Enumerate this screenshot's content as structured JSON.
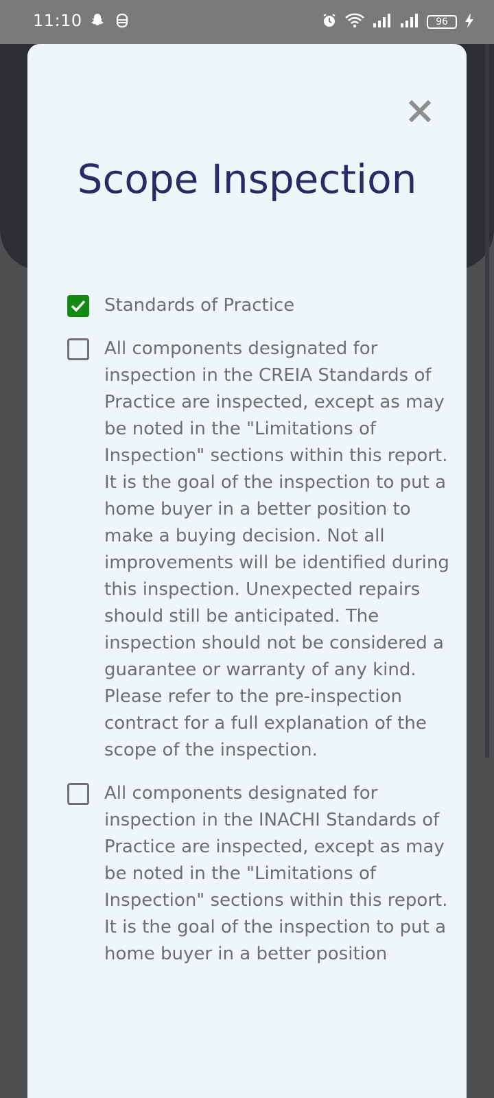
{
  "status_bar": {
    "time": "11:10",
    "battery": "96",
    "left_icons": [
      "snapchat-icon",
      "app-notification-icon"
    ],
    "right_icons": [
      "alarm-icon",
      "wifi-icon",
      "signal-icon",
      "signal-icon",
      "battery-icon",
      "charging-icon"
    ]
  },
  "modal": {
    "close_icon": "close-icon",
    "title": "Scope Inspection",
    "options": [
      {
        "checked": true,
        "label": "Standards of Practice"
      },
      {
        "checked": false,
        "label": "All components designated for inspection in the CREIA Standards of Practice are inspected, except as may be noted in the \"Limitations of Inspection\" sections within this report. It is the goal of the inspection to put a home buyer in a better position to make a buying decision. Not all improvements will be identified during this inspection. Unexpected repairs should still be anticipated. The inspection should not be considered a guarantee or warranty of any kind. Please refer to the pre-inspection contract for a full explanation of the scope of the inspection."
      },
      {
        "checked": false,
        "label": "All components designated for inspection in the INACHI Standards of Practice are inspected, except as may be noted in the \"Limitations of Inspection\" sections within this report. It is the goal of the inspection to put a home buyer in a better position"
      }
    ]
  },
  "colors": {
    "title": "#2b2966",
    "checkbox_checked": "#138a13",
    "modal_background": "#eff6f9",
    "text": "#6e6e6e"
  }
}
